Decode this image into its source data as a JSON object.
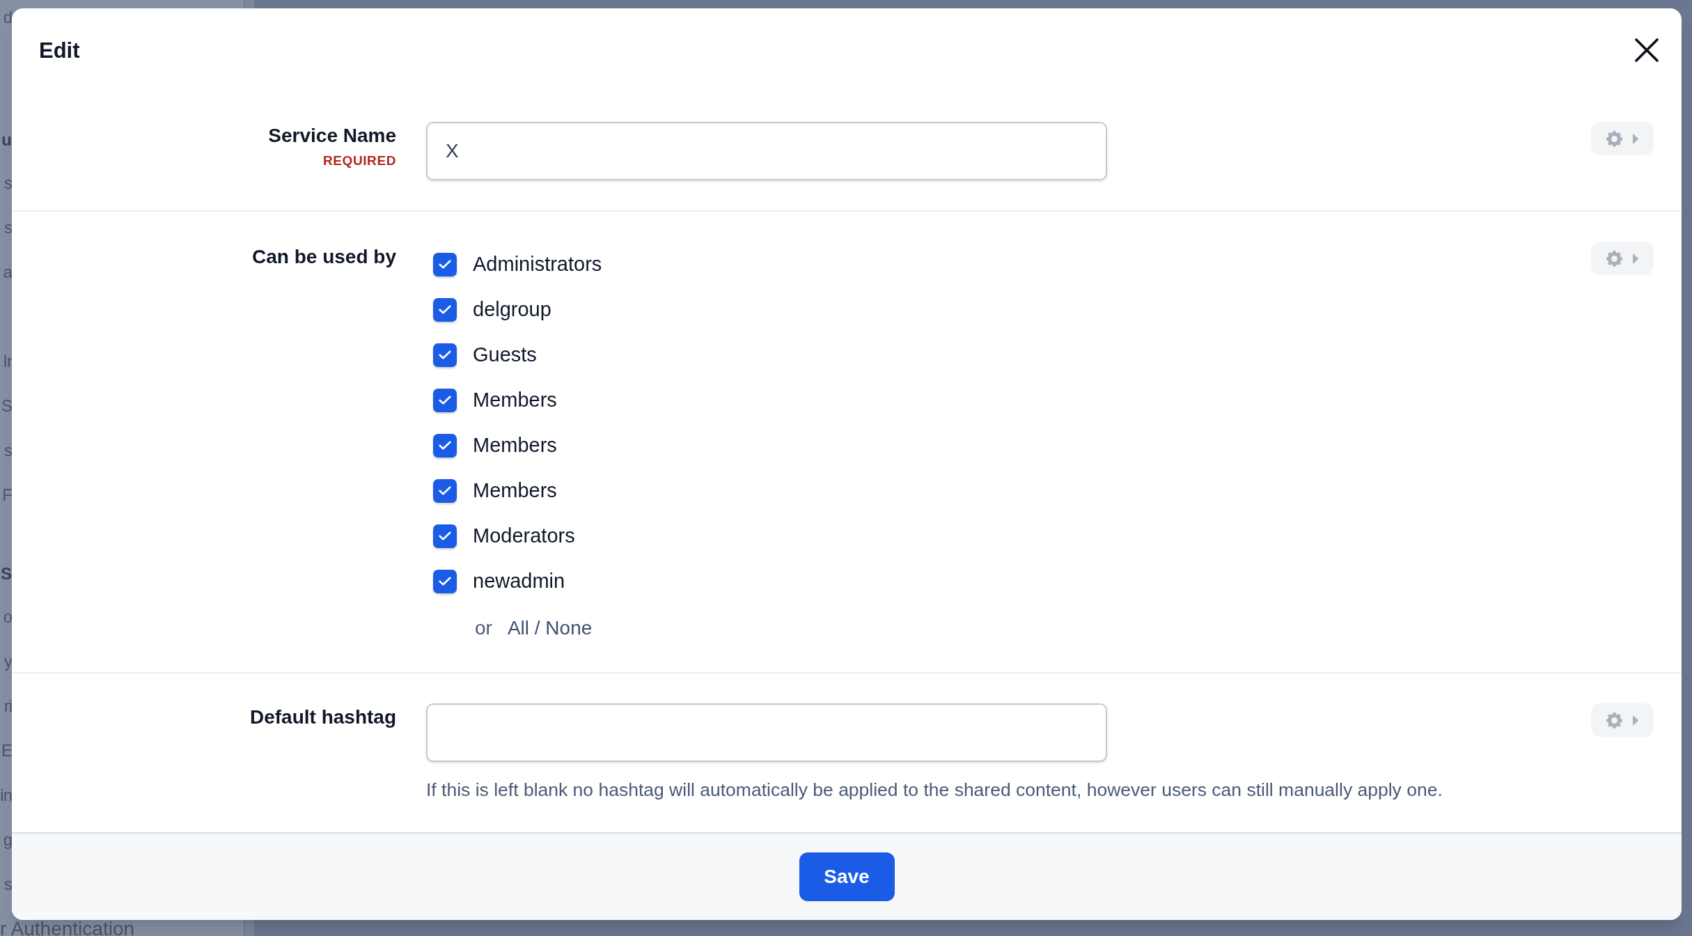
{
  "background": {
    "sidebar": [
      {
        "items": [
          "d"
        ]
      },
      {
        "heading": "u",
        "items": [
          "s",
          "s",
          "a"
        ]
      },
      {
        "items": [
          "Ir",
          "S",
          "s",
          "F"
        ]
      },
      {
        "heading": "S",
        "items": [
          "o",
          "y",
          "ri",
          "E",
          "in",
          "g",
          "s",
          "r Authentication"
        ]
      }
    ]
  },
  "dialog": {
    "title": "Edit",
    "fields": [
      {
        "kind": "text",
        "label": "Service Name",
        "required_label": "REQUIRED",
        "value": "X"
      },
      {
        "kind": "checklist",
        "label": "Can be used by",
        "options": [
          {
            "label": "Administrators",
            "checked": true
          },
          {
            "label": "delgroup",
            "checked": true
          },
          {
            "label": "Guests",
            "checked": true
          },
          {
            "label": "Members",
            "checked": true
          },
          {
            "label": "Members",
            "checked": true
          },
          {
            "label": "Members",
            "checked": true
          },
          {
            "label": "Moderators",
            "checked": true
          },
          {
            "label": "newadmin",
            "checked": true
          }
        ],
        "or_label": "or",
        "select_all_none": "All / None"
      },
      {
        "kind": "text",
        "label": "Default hashtag",
        "help": "If this is left blank no hashtag will automatically be applied to the shared content, however users can still manually apply one."
      }
    ],
    "footer": {
      "save": "Save"
    }
  }
}
